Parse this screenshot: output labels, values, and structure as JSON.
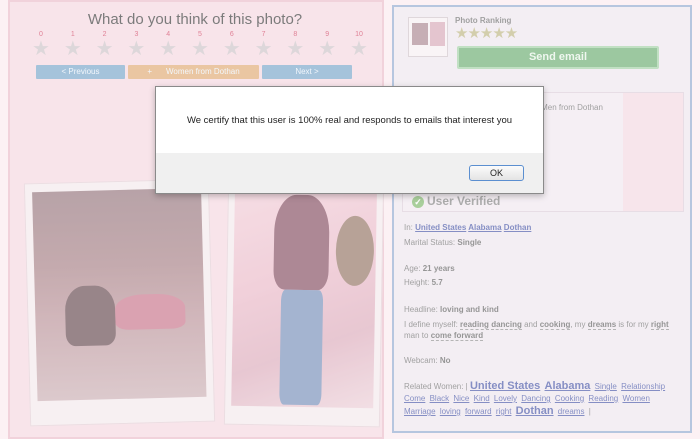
{
  "photo_rating": {
    "question": "What do you think of this photo?",
    "scale": [
      "0",
      "1",
      "2",
      "3",
      "4",
      "5",
      "6",
      "7",
      "8",
      "9",
      "10"
    ]
  },
  "navigation": {
    "previous": "< Previous",
    "women_from": "Women from Dothan",
    "women_prefix": "+",
    "next": "Next >"
  },
  "sidebar": {
    "photo_ranking_label": "Photo Ranking",
    "photo_ranking_stars": 4.5,
    "send_email": "Send email",
    "seeking_text": "ng Men from Dothan",
    "verified_label": "User Verified",
    "location_label": "In:",
    "location_links": [
      "United States",
      "Alabama",
      "Dothan"
    ],
    "marital_label": "Marital Status:",
    "marital_value": "Single",
    "age_label": "Age:",
    "age_value": "21 years",
    "height_label": "Height:",
    "height_value": "5.7",
    "headline_label": "Headline:",
    "headline_value": "loving and kind",
    "define_label": "I define myself:",
    "define_parts": [
      "reading",
      "dancing",
      "and",
      "cooking",
      ", my",
      "dreams",
      "is for my",
      "right",
      "man to",
      "come forward"
    ],
    "webcam_label": "Webcam:",
    "webcam_value": "No",
    "related_label": "Related Women: |",
    "related_links": [
      "United States",
      "Alabama",
      "Single",
      "Relationship",
      "Come",
      "Black",
      "Nice",
      "Kind",
      "Lovely",
      "Dancing",
      "Cooking",
      "Reading",
      "Women",
      "Marriage",
      "loving",
      "forward",
      "right",
      "Dothan",
      "dreams"
    ],
    "related_end": "|"
  },
  "dialog": {
    "message": "We certify that this user is 100% real and responds to emails that interest you",
    "ok": "OK"
  },
  "colors": {
    "background": "#fbe9ee",
    "send_email": "#5fa766",
    "nav_blue": "#6f9ec5",
    "nav_orange": "#dea46a",
    "link": "#3b4aa0"
  }
}
